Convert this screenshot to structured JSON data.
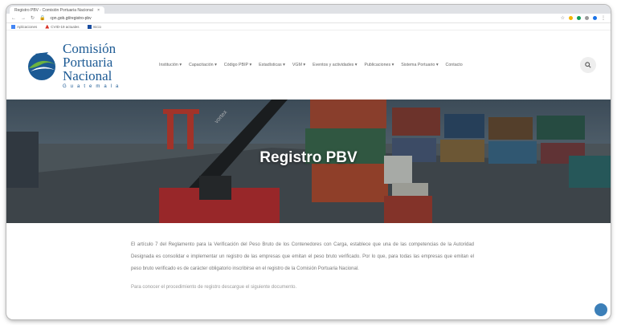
{
  "browser": {
    "tab_title": "Registro PBV - Comisión Portuaria Nacional",
    "url": "cpn.gob.gt/registro-pbv",
    "bookmarks": [
      "Aplicaciones",
      "CVID-19 actuales",
      "Inicio"
    ]
  },
  "logo": {
    "line1": "Comisión",
    "line2": "Portuaria",
    "line3": "Nacional",
    "line4": "Guatemala"
  },
  "nav": {
    "items": [
      "Institución",
      "Capacitación",
      "Código PBIP",
      "Estadísticas",
      "VGM",
      "Eventos y actividades",
      "Publicaciones",
      "Sistema Portuario",
      "Contacto"
    ]
  },
  "hero": {
    "title": "Registro PBV",
    "container_brand": "vortex"
  },
  "content": {
    "paragraph": "El artículo 7 del Reglamento para la Verificación del Peso Bruto de los Contenedores con Carga, establece que una de las competencias de la Autoridad Designada es consolidar e implementar un registro de las empresas que emitan el peso bruto verificado. Por lo que, para todas las empresas que emitan el peso bruto verificado es de carácter obligatorio inscribirse en el registro de la Comisión Portuaria Nacional.",
    "paragraph2": "Para conocer el procedimiento de registro descargue el siguiente documento."
  },
  "colors": {
    "brand_blue": "#1c5a94",
    "brand_green": "#6cb33f"
  }
}
